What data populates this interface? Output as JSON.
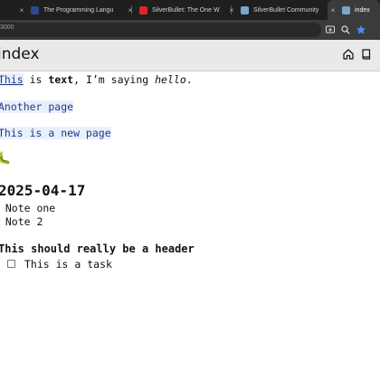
{
  "tabs": [
    {
      "title": "The Programming Langu",
      "close": "×"
    },
    {
      "title": "SilverBullet: The One W",
      "close": "×"
    },
    {
      "title": "SilverBullet Community",
      "close": "×"
    },
    {
      "title": "index",
      "close": "×"
    }
  ],
  "address_bar": {
    "url": "3000"
  },
  "page": {
    "title": "index"
  },
  "content": {
    "line1": {
      "link": "This",
      "is1": " is ",
      "bold": "text",
      "rest": ", I’m saying ",
      "italic": "hello",
      "end": "."
    },
    "link_another": "Another page",
    "link_new": "This is a new page",
    "emoji": "🐛",
    "date_heading": "2025-04-17",
    "notes": [
      "* Note one",
      "* Note 2"
    ],
    "header_line": "This should really be a header",
    "task": "This is a task"
  },
  "colors": {
    "link": "#1d3a8a",
    "accent_blue": "#4a8cf7"
  }
}
